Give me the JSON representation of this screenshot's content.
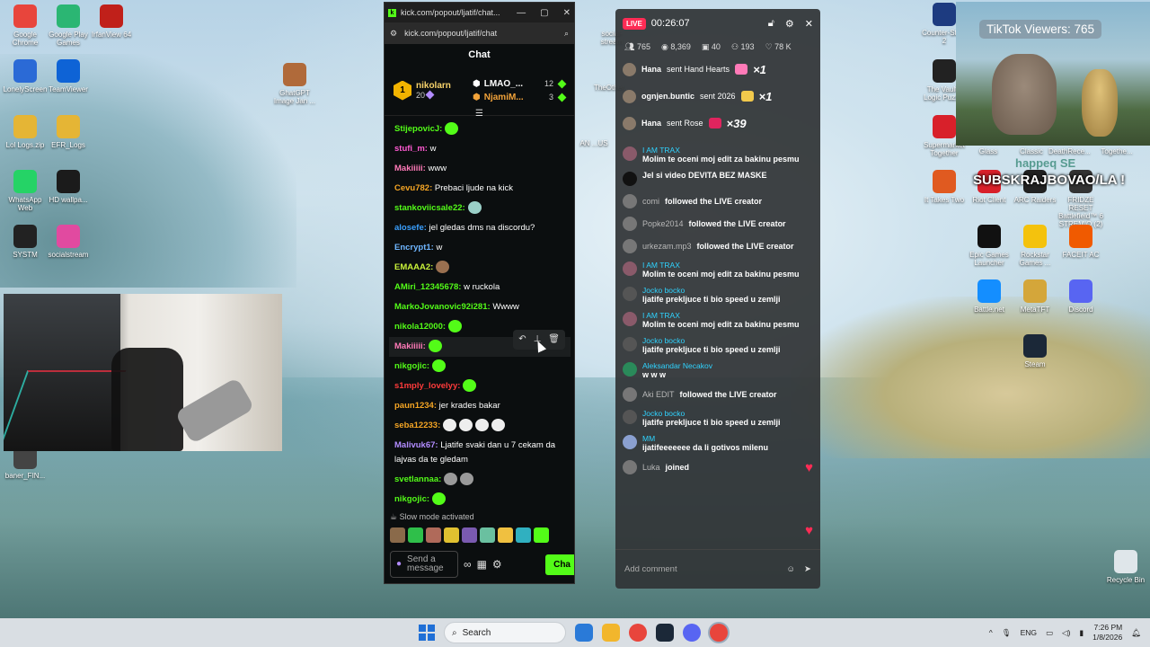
{
  "desktop": {
    "icons_left": [
      {
        "label": "Google Chrome",
        "color": "#e8453c",
        "glyph": "chrome-icon"
      },
      {
        "label": "Google Play Games",
        "color": "#2bb673",
        "glyph": "play-games-icon"
      },
      {
        "label": "IrfanView 64",
        "color": "#c0201a",
        "glyph": "irfanview-icon"
      },
      {
        "label": "LonelyScreen",
        "color": "#2b6ad6",
        "glyph": "screen-icon"
      },
      {
        "label": "TeamViewer",
        "color": "#0e63d6",
        "glyph": "teamviewer-icon"
      },
      {
        "label": "GhatGPT Image Jan ...",
        "color": "#b06a3a",
        "glyph": "image-icon"
      },
      {
        "label": "Lol Logs.zip",
        "color": "#e5b535",
        "glyph": "zip-icon"
      },
      {
        "label": "EFR_Logs",
        "color": "#e5b535",
        "glyph": "folder-icon"
      },
      {
        "label": "WhatsApp Web",
        "color": "#25d366",
        "glyph": "whatsapp-icon"
      },
      {
        "label": "HD wallpa...",
        "color": "#1b1b1b",
        "glyph": "wallpaper-icon"
      },
      {
        "label": "SYSTM",
        "color": "#222",
        "glyph": "systm-icon"
      },
      {
        "label": "socialstream",
        "color": "#e14aa0",
        "glyph": "socialstream-icon"
      },
      {
        "label": "baner_FIN...",
        "color": "#444",
        "glyph": "banner-icon"
      }
    ],
    "icons_right": [
      {
        "label": "Counter-Stri... 2",
        "color": "#1d3b80",
        "glyph": "cs2-icon"
      },
      {
        "label": "The Vault - Logic Puzz...",
        "color": "#222",
        "glyph": "vault-icon"
      },
      {
        "label": "Supermarket Together",
        "color": "#d8202a",
        "glyph": "supermarket-icon"
      },
      {
        "label": "It Takes Two",
        "color": "#e05a20",
        "glyph": "ittakestwo-icon"
      },
      {
        "label": "Riot Client",
        "color": "#d8202a",
        "glyph": "riot-icon"
      },
      {
        "label": "ARC Raiders",
        "color": "#222",
        "glyph": "arc-icon"
      },
      {
        "label": "FRIDZE RESET Battlefield™ 6 STREMIO (2)",
        "color": "#333",
        "glyph": "battlefield-icon"
      },
      {
        "label": "Epic Games Launcher",
        "color": "#111",
        "glyph": "epic-icon"
      },
      {
        "label": "Rockstar Games ...",
        "color": "#f4c20d",
        "glyph": "rockstar-icon"
      },
      {
        "label": "FACEIT AC",
        "color": "#f05a00",
        "glyph": "faceit-icon"
      },
      {
        "label": "Battle.net",
        "color": "#148eff",
        "glyph": "battlenet-icon"
      },
      {
        "label": "MetaTFT",
        "color": "#d4a63a",
        "glyph": "metatft-icon"
      },
      {
        "label": "Discord",
        "color": "#5865f2",
        "glyph": "discord-icon"
      },
      {
        "label": "Steam",
        "color": "#1b2838",
        "glyph": "steam-icon"
      },
      {
        "label": "Recycle Bin",
        "color": "#dfe6ea",
        "glyph": "recycle-bin-icon"
      }
    ],
    "partial_labels": [
      "Glass",
      "Classic",
      "DeathRece...",
      "Togethe...",
      "social-stream",
      "TheOther...",
      "AN ...US"
    ]
  },
  "kick": {
    "window_title": "kick.com/popout/ljatif/chat...",
    "url": "kick.com/popout/ljatif/chat",
    "header": "Chat",
    "leader_rank": "1",
    "leader_name": "nikolarn",
    "leader_count": "20",
    "second_name": "LMAO_...",
    "second_count": "12",
    "third_name": "NjamiM...",
    "third_count": "3",
    "messages": [
      {
        "user": "StijepovicJ:",
        "color": "#53fc18",
        "text": "",
        "emotes": [
          "#53fc18"
        ]
      },
      {
        "user": "stufi_m:",
        "color": "#ff5ad2",
        "text": "w",
        "emotes": []
      },
      {
        "user": "Makiiiii:",
        "color": "#ff7ab8",
        "text": "www",
        "emotes": []
      },
      {
        "user": "Cevu782:",
        "color": "#f5a524",
        "text": "Prebaci ljude na kick",
        "emotes": []
      },
      {
        "user": "stankoviicsale22:",
        "color": "#53fc18",
        "text": "",
        "emotes": [
          "#9ad0c8"
        ]
      },
      {
        "user": "alosefe:",
        "color": "#3aa0ff",
        "text": "jel gledas dms na discordu?",
        "emotes": []
      },
      {
        "user": "Encrypt1:",
        "color": "#6fb6ff",
        "text": "w",
        "emotes": []
      },
      {
        "user": "EMAAA2:",
        "color": "#c9f23a",
        "text": "",
        "emotes": [
          "#9a7050"
        ]
      },
      {
        "user": "AMiri_12345678:",
        "color": "#53fc18",
        "text": "w ruckola",
        "emotes": []
      },
      {
        "user": "MarkoJovanovic92i281:",
        "color": "#53fc18",
        "text": "Wwww",
        "emotes": []
      },
      {
        "user": "nikola12000:",
        "color": "#53fc18",
        "text": "",
        "emotes": [
          "#53fc18"
        ]
      },
      {
        "user": "Makiiiii:",
        "color": "#ff7ab8",
        "text": "",
        "emotes": [
          "#53fc18"
        ]
      },
      {
        "user": "nikgojic:",
        "color": "#53fc18",
        "text": "",
        "emotes": [
          "#53fc18"
        ]
      },
      {
        "user": "s1mply_lovelyy:",
        "color": "#ff3b3b",
        "text": "",
        "emotes": [
          "#53fc18"
        ]
      },
      {
        "user": "paun1234:",
        "color": "#f5a524",
        "text": "jer krades bakar",
        "emotes": []
      },
      {
        "user": "seba12233:",
        "color": "#f5a524",
        "text": "",
        "emotes": [
          "#eee",
          "#eee",
          "#eee",
          "#eee"
        ]
      },
      {
        "user": "Malivuk67:",
        "color": "#b28cff",
        "text": "Ljatife svaki dan u 7 cekam da lajvas da te gledam",
        "emotes": []
      },
      {
        "user": "svetlannaa:",
        "color": "#53fc18",
        "text": "",
        "emotes": [
          "#999",
          "#999"
        ]
      },
      {
        "user": "nikgojic:",
        "color": "#53fc18",
        "text": "",
        "emotes": [
          "#53fc18"
        ]
      }
    ],
    "slow_mode": "Slow mode activated",
    "input_placeholder": "Send a message",
    "chat_button": "Cha"
  },
  "tiktok": {
    "live_label": "LIVE",
    "timer": "00:26:07",
    "stats": {
      "viewers": "765",
      "views": "8,369",
      "gifters": "40",
      "members": "193",
      "likes": "78 K"
    },
    "gifts": [
      {
        "user": "Hana",
        "action": "sent Hand Hearts",
        "count": "×1",
        "color": "#ff7ab8"
      },
      {
        "user": "ognjen.buntic",
        "action": "sent 2026",
        "count": "×1",
        "color": "#f2c94c"
      },
      {
        "user": "Hana",
        "action": "sent Rose",
        "count": "×39",
        "color": "#e0245e"
      }
    ],
    "feed": [
      {
        "type": "msg",
        "name": "I AM TRAX",
        "text": "Molim te oceni moj edit za bakinu pesmu",
        "av": "#8a5a6a"
      },
      {
        "type": "msg",
        "name": "",
        "text": "Jel si video DEVITA BEZ MASKE",
        "av": "#111"
      },
      {
        "type": "follow",
        "name": "comi",
        "text": "followed the LIVE creator",
        "av": "#777"
      },
      {
        "type": "follow",
        "name": "Popke2014",
        "text": "followed the LIVE creator",
        "av": "#777"
      },
      {
        "type": "follow",
        "name": "urkezam.mp3",
        "text": "followed the LIVE creator",
        "av": "#777"
      },
      {
        "type": "msg",
        "name": "I AM TRAX",
        "text": "Molim te oceni moj edit za bakinu pesmu",
        "av": "#8a5a6a"
      },
      {
        "type": "msg",
        "name": "Jocko bocko",
        "text": "ljatife prekljuce ti bio speed u zemlji",
        "av": "#555"
      },
      {
        "type": "msg",
        "name": "I AM TRAX",
        "text": "Molim te oceni moj edit za bakinu pesmu",
        "av": "#8a5a6a"
      },
      {
        "type": "msg",
        "name": "Jocko bocko",
        "text": "ljatife prekljuce ti bio speed u zemlji",
        "av": "#555"
      },
      {
        "type": "msg",
        "name": "Aleksandar Necakov",
        "text": "w w w",
        "av": "#2a8a5a"
      },
      {
        "type": "follow",
        "name": "Aki EDIT",
        "text": "followed the LIVE creator",
        "av": "#777"
      },
      {
        "type": "msg",
        "name": "Jocko bocko",
        "text": "ljatife prekljuce ti bio speed u zemlji",
        "av": "#555"
      },
      {
        "type": "msg",
        "name": "MM",
        "text": "ijatifeeeeeee da li gotivos milenu",
        "av": "#8aa0d0"
      },
      {
        "type": "follow",
        "name": "Luka",
        "text": "joined",
        "av": "#777"
      }
    ],
    "comment_placeholder": "Add comment"
  },
  "viewers_widget": {
    "text": "TikTok Viewers: 765"
  },
  "overlay": {
    "line1": "happeq SE",
    "line2": "SUBSKRAJBOVAO/LA !"
  },
  "taskbar": {
    "search_label": "Search",
    "lang": "ENG",
    "time": "7:26 PM",
    "date": "1/8/2026"
  }
}
